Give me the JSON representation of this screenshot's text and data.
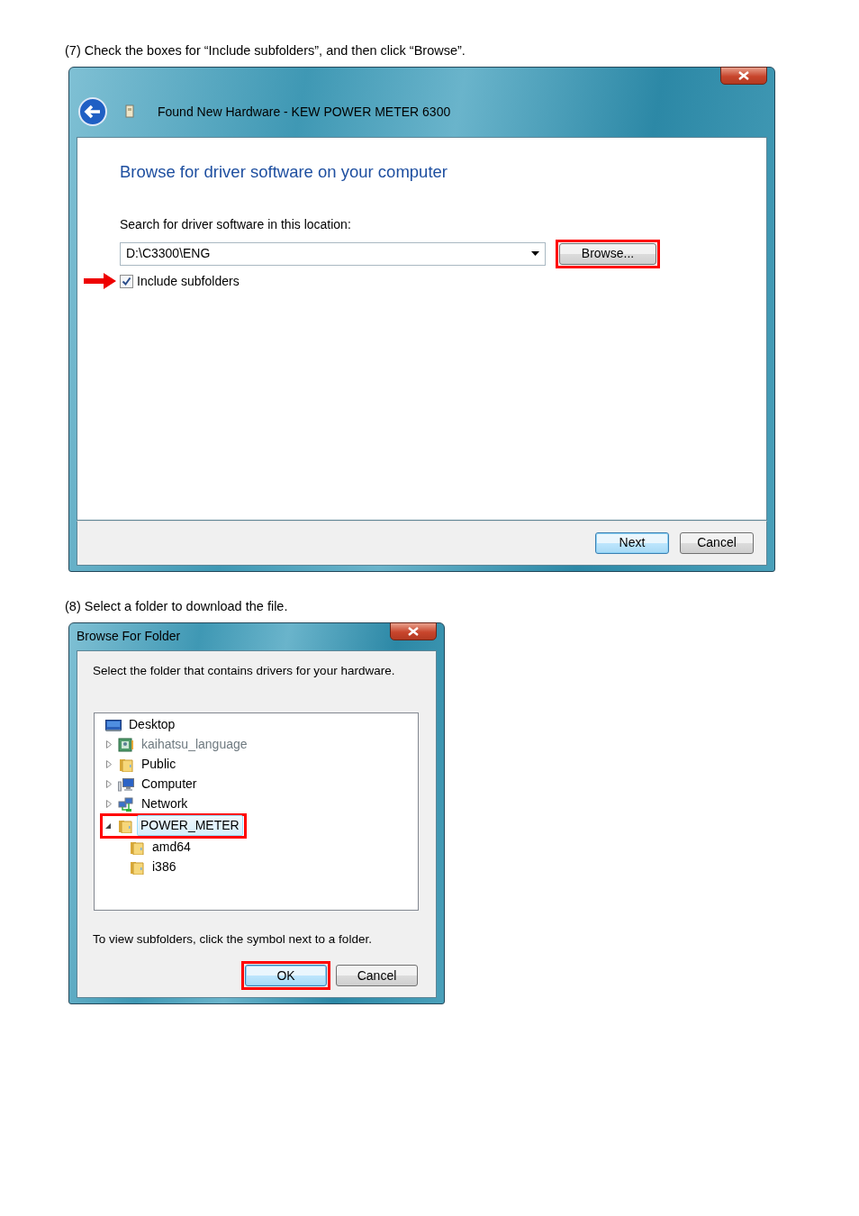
{
  "steps": [
    {
      "caption": "(7) Check the boxes for “Include subfolders”, and then click “Browse”.",
      "window": {
        "kind": "wizard",
        "title": "Found New Hardware - KEW POWER METER 6300",
        "heading": "Browse for driver software on your computer",
        "location_label": "Search for driver software in this location:",
        "location_value": "D:\\C3300\\ENG",
        "browse_button": {
          "label": "Browse...",
          "default": false,
          "highlighted": true
        },
        "checkbox": {
          "label": "Include subfolders",
          "checked": true,
          "pointed": true
        },
        "buttons": [
          {
            "label": "Next",
            "default": true,
            "highlighted": false
          },
          {
            "label": "Cancel",
            "default": false,
            "highlighted": false
          }
        ]
      }
    },
    {
      "caption": "(8) Select a folder to download the file.",
      "window": {
        "kind": "folder_dialog",
        "title": "Browse For Folder",
        "instruction": "Select the folder that contains drivers for your hardware.",
        "tree": [
          {
            "label": "Desktop",
            "kind": "desktop",
            "selected": false,
            "highlighted": false,
            "children": [
              {
                "label": "kaihatsu_language",
                "kind": "contact",
                "expanded": false,
                "selected": false,
                "highlighted": false
              },
              {
                "label": "Public",
                "kind": "folder",
                "expanded": false,
                "selected": false,
                "highlighted": false
              },
              {
                "label": "Computer",
                "kind": "computer",
                "expanded": false,
                "selected": false,
                "highlighted": false
              },
              {
                "label": "Network",
                "kind": "network",
                "expanded": false,
                "selected": false,
                "highlighted": false
              },
              {
                "label": "POWER_METER",
                "kind": "folder",
                "expanded": true,
                "selected": true,
                "highlighted": true,
                "children": [
                  {
                    "label": "amd64",
                    "kind": "folder",
                    "selected": false,
                    "highlighted": false
                  },
                  {
                    "label": "i386",
                    "kind": "folder",
                    "selected": false,
                    "highlighted": false
                  }
                ]
              }
            ]
          }
        ],
        "hint": "To view subfolders, click the symbol next to a folder.",
        "buttons": [
          {
            "label": "OK",
            "default": true,
            "highlighted": true
          },
          {
            "label": "Cancel",
            "default": false,
            "highlighted": false
          }
        ]
      }
    }
  ]
}
